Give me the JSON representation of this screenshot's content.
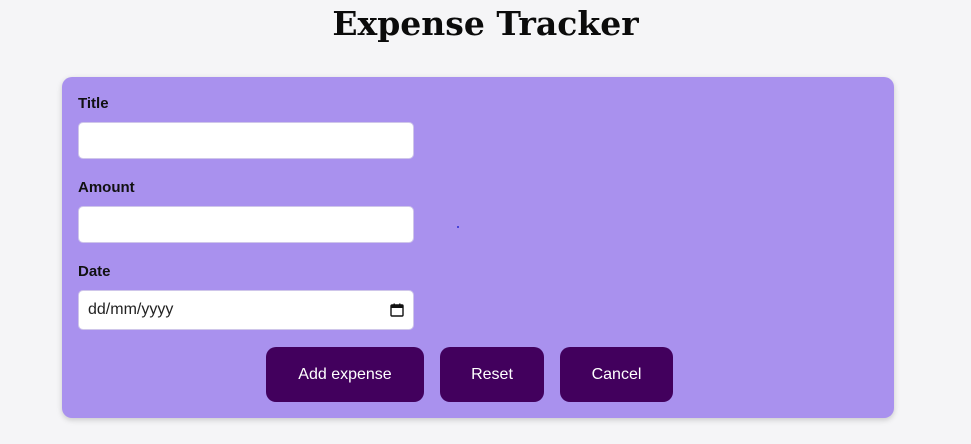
{
  "header": {
    "title": "Expense Tracker"
  },
  "form": {
    "title_label": "Title",
    "title_value": "",
    "amount_label": "Amount",
    "amount_value": "",
    "date_label": "Date",
    "date_placeholder": "dd/mm/yyyy",
    "date_icon": "calendar-icon"
  },
  "actions": {
    "add_label": "Add expense",
    "reset_label": "Reset",
    "cancel_label": "Cancel"
  },
  "colors": {
    "page_background": "#f5f5f7",
    "card_background": "#a991ee",
    "button_background": "#42005d",
    "button_text": "#ffffff"
  }
}
